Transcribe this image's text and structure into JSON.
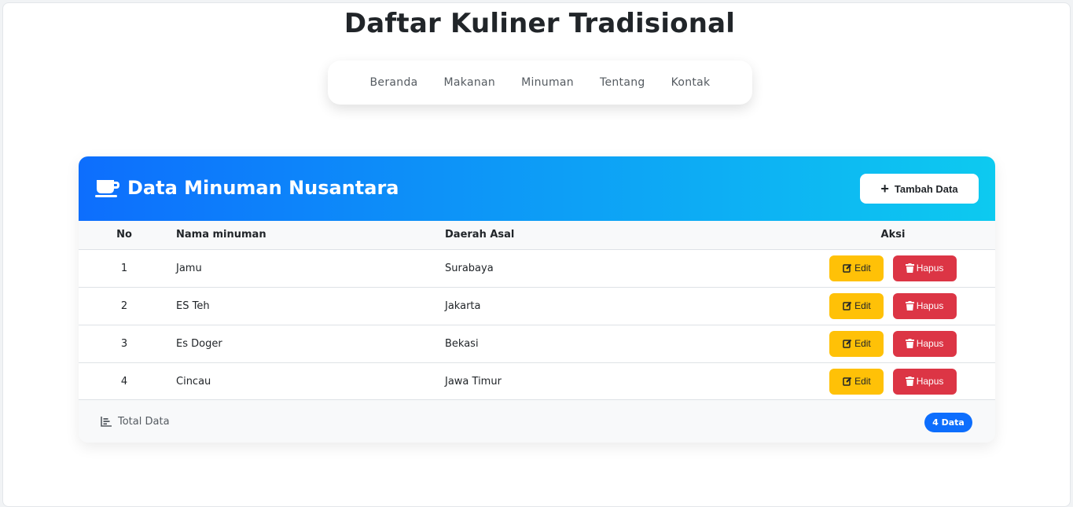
{
  "page": {
    "title": "Daftar Kuliner Tradisional"
  },
  "nav": {
    "items": [
      {
        "label": "Beranda"
      },
      {
        "label": "Makanan"
      },
      {
        "label": "Minuman"
      },
      {
        "label": "Tentang"
      },
      {
        "label": "Kontak"
      }
    ]
  },
  "card": {
    "title": "Data Minuman Nusantara",
    "title_icon": "coffee-cup-icon",
    "add_button": "Tambah Data",
    "header_gradient": [
      "#0d6efd",
      "#0dcaf0"
    ]
  },
  "table": {
    "headers": {
      "no": "No",
      "name": "Nama minuman",
      "region": "Daerah Asal",
      "action": "Aksi"
    },
    "rows": [
      {
        "no": "1",
        "name": "Jamu",
        "region": "Surabaya"
      },
      {
        "no": "2",
        "name": "ES Teh",
        "region": "Jakarta"
      },
      {
        "no": "3",
        "name": "Es Doger",
        "region": "Bekasi"
      },
      {
        "no": "4",
        "name": "Cincau",
        "region": "Jawa Timur"
      }
    ],
    "edit_label": "Edit",
    "delete_label": "Hapus"
  },
  "footer": {
    "label": "Total Data",
    "count_badge": "4 Data"
  },
  "colors": {
    "edit": "#ffc107",
    "delete": "#dc3545",
    "badge": "#0d6efd"
  }
}
